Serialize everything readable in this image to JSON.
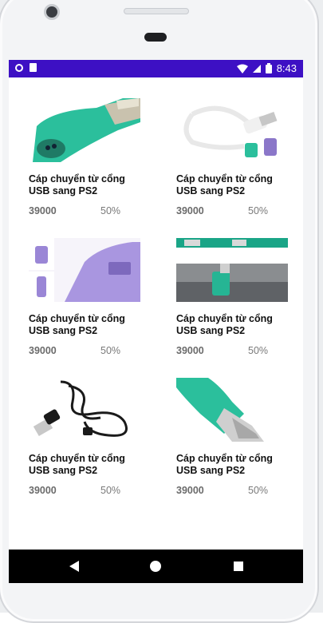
{
  "status_bar": {
    "time": "8:43"
  },
  "products": [
    {
      "title": "Cáp chuyển từ cổng USB sang PS2",
      "price": "39000",
      "discount": "50%",
      "image_icon": "usb-ps2-green-adapter-icon"
    },
    {
      "title": "Cáp chuyển từ cổng USB sang PS2",
      "price": "39000",
      "discount": "50%",
      "image_icon": "usb-ps2-splitter-cable-icon"
    },
    {
      "title": "Cáp chuyển từ cổng USB sang PS2",
      "price": "39000",
      "discount": "50%",
      "image_icon": "purple-ps2-adapter-icon"
    },
    {
      "title": "Cáp chuyển từ cổng USB sang PS2",
      "price": "39000",
      "discount": "50%",
      "image_icon": "green-adapters-port-icon"
    },
    {
      "title": "Cáp chuyển từ cổng USB sang PS2",
      "price": "39000",
      "discount": "50%",
      "image_icon": "black-usb-cable-icon"
    },
    {
      "title": "Cáp chuyển từ cổng USB sang PS2",
      "price": "39000",
      "discount": "50%",
      "image_icon": "green-usb-plug-icon"
    }
  ],
  "colors": {
    "status_bar": "#3d10c4",
    "nav_bar": "#000000",
    "accent_green": "#2bbf9c",
    "accent_purple": "#9a86d6"
  }
}
